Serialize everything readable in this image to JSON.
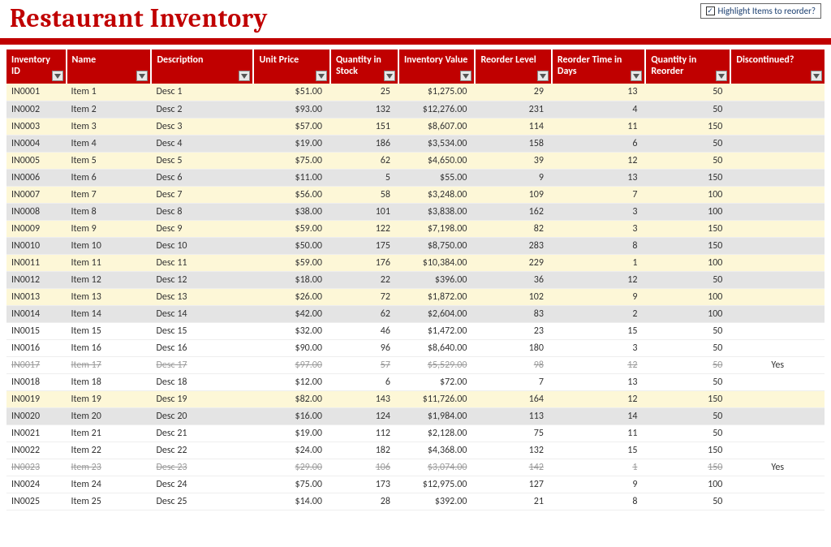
{
  "title": "Restaurant Inventory",
  "highlight_checkbox": {
    "checked": true,
    "label": "Highlight Items to reorder?"
  },
  "columns": [
    {
      "label": "Inventory ID"
    },
    {
      "label": "Name"
    },
    {
      "label": "Description"
    },
    {
      "label": "Unit Price"
    },
    {
      "label": "Quantity in Stock"
    },
    {
      "label": "Inventory Value"
    },
    {
      "label": "Reorder Level"
    },
    {
      "label": "Reorder Time in Days"
    },
    {
      "label": "Quantity in Reorder"
    },
    {
      "label": "Discontinued?"
    }
  ],
  "chart_data": {
    "type": "table",
    "columns": [
      "Inventory ID",
      "Name",
      "Description",
      "Unit Price",
      "Quantity in Stock",
      "Inventory Value",
      "Reorder Level",
      "Reorder Time in Days",
      "Quantity in Reorder",
      "Discontinued?"
    ],
    "rows": [
      [
        "IN0001",
        "Item 1",
        "Desc 1",
        "$51.00",
        "25",
        "$1,275.00",
        "29",
        "13",
        "50",
        ""
      ],
      [
        "IN0002",
        "Item 2",
        "Desc 2",
        "$93.00",
        "132",
        "$12,276.00",
        "231",
        "4",
        "50",
        ""
      ],
      [
        "IN0003",
        "Item 3",
        "Desc 3",
        "$57.00",
        "151",
        "$8,607.00",
        "114",
        "11",
        "150",
        ""
      ],
      [
        "IN0004",
        "Item 4",
        "Desc 4",
        "$19.00",
        "186",
        "$3,534.00",
        "158",
        "6",
        "50",
        ""
      ],
      [
        "IN0005",
        "Item 5",
        "Desc 5",
        "$75.00",
        "62",
        "$4,650.00",
        "39",
        "12",
        "50",
        ""
      ],
      [
        "IN0006",
        "Item 6",
        "Desc 6",
        "$11.00",
        "5",
        "$55.00",
        "9",
        "13",
        "150",
        ""
      ],
      [
        "IN0007",
        "Item 7",
        "Desc 7",
        "$56.00",
        "58",
        "$3,248.00",
        "109",
        "7",
        "100",
        ""
      ],
      [
        "IN0008",
        "Item 8",
        "Desc 8",
        "$38.00",
        "101",
        "$3,838.00",
        "162",
        "3",
        "100",
        ""
      ],
      [
        "IN0009",
        "Item 9",
        "Desc 9",
        "$59.00",
        "122",
        "$7,198.00",
        "82",
        "3",
        "150",
        ""
      ],
      [
        "IN0010",
        "Item 10",
        "Desc 10",
        "$50.00",
        "175",
        "$8,750.00",
        "283",
        "8",
        "150",
        ""
      ],
      [
        "IN0011",
        "Item 11",
        "Desc 11",
        "$59.00",
        "176",
        "$10,384.00",
        "229",
        "1",
        "100",
        ""
      ],
      [
        "IN0012",
        "Item 12",
        "Desc 12",
        "$18.00",
        "22",
        "$396.00",
        "36",
        "12",
        "50",
        ""
      ],
      [
        "IN0013",
        "Item 13",
        "Desc 13",
        "$26.00",
        "72",
        "$1,872.00",
        "102",
        "9",
        "100",
        ""
      ],
      [
        "IN0014",
        "Item 14",
        "Desc 14",
        "$42.00",
        "62",
        "$2,604.00",
        "83",
        "2",
        "100",
        ""
      ],
      [
        "IN0015",
        "Item 15",
        "Desc 15",
        "$32.00",
        "46",
        "$1,472.00",
        "23",
        "15",
        "50",
        ""
      ],
      [
        "IN0016",
        "Item 16",
        "Desc 16",
        "$90.00",
        "96",
        "$8,640.00",
        "180",
        "3",
        "50",
        ""
      ],
      [
        "IN0017",
        "Item 17",
        "Desc 17",
        "$97.00",
        "57",
        "$5,529.00",
        "98",
        "12",
        "50",
        "Yes"
      ],
      [
        "IN0018",
        "Item 18",
        "Desc 18",
        "$12.00",
        "6",
        "$72.00",
        "7",
        "13",
        "50",
        ""
      ],
      [
        "IN0019",
        "Item 19",
        "Desc 19",
        "$82.00",
        "143",
        "$11,726.00",
        "164",
        "12",
        "150",
        ""
      ],
      [
        "IN0020",
        "Item 20",
        "Desc 20",
        "$16.00",
        "124",
        "$1,984.00",
        "113",
        "14",
        "50",
        ""
      ],
      [
        "IN0021",
        "Item 21",
        "Desc 21",
        "$19.00",
        "112",
        "$2,128.00",
        "75",
        "11",
        "50",
        ""
      ],
      [
        "IN0022",
        "Item 22",
        "Desc 22",
        "$24.00",
        "182",
        "$4,368.00",
        "132",
        "15",
        "150",
        ""
      ],
      [
        "IN0023",
        "Item 23",
        "Desc 23",
        "$29.00",
        "106",
        "$3,074.00",
        "142",
        "1",
        "150",
        "Yes"
      ],
      [
        "IN0024",
        "Item 24",
        "Desc 24",
        "$75.00",
        "173",
        "$12,975.00",
        "127",
        "9",
        "100",
        ""
      ],
      [
        "IN0025",
        "Item 25",
        "Desc 25",
        "$14.00",
        "28",
        "$392.00",
        "21",
        "8",
        "50",
        ""
      ]
    ]
  },
  "bands": [
    "yellow",
    "gray",
    "yellow",
    "gray",
    "yellow",
    "gray",
    "yellow",
    "gray",
    "yellow",
    "gray",
    "yellow",
    "gray",
    "yellow",
    "gray",
    "white",
    "white",
    "white",
    "white",
    "yellow",
    "gray",
    "white",
    "white",
    "white",
    "white",
    "white"
  ]
}
